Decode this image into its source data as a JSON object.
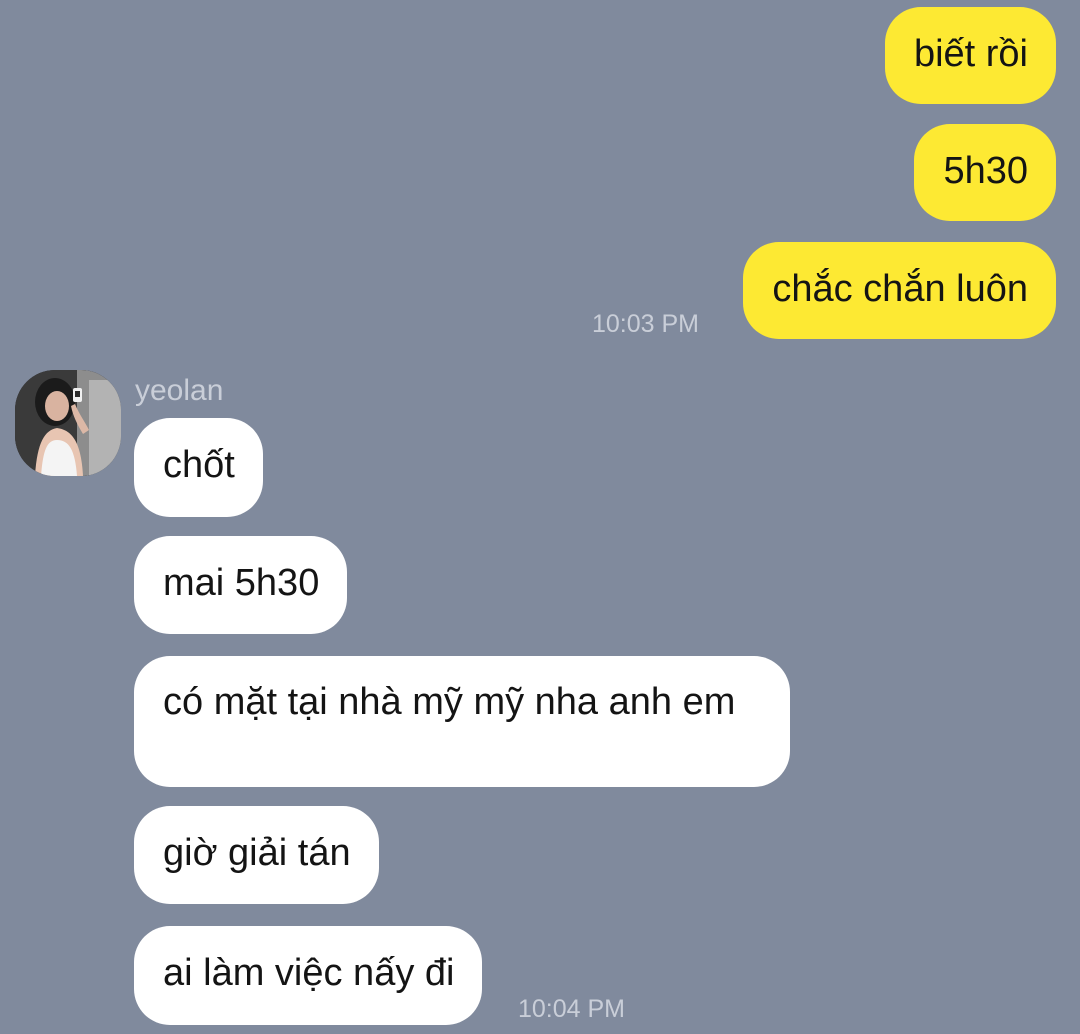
{
  "chat": {
    "outgoing": [
      {
        "text": "biết rồi"
      },
      {
        "text": "5h30"
      },
      {
        "text": "chắc chắn luôn"
      }
    ],
    "outgoing_time": "10:03 PM",
    "incoming_sender": "yeolan",
    "incoming": [
      {
        "text": "chốt"
      },
      {
        "text": "mai 5h30"
      },
      {
        "text": "có mặt tại nhà mỹ mỹ nha anh em"
      },
      {
        "text": "giờ giải tán"
      },
      {
        "text": "ai làm việc nấy đi"
      }
    ],
    "incoming_time": "10:04 PM"
  },
  "colors": {
    "background": "#808a9d",
    "outgoing_bubble": "#fde933",
    "incoming_bubble": "#ffffff",
    "meta_text": "#c9ced8"
  },
  "avatar": {
    "icon": "user-photo-avatar"
  }
}
